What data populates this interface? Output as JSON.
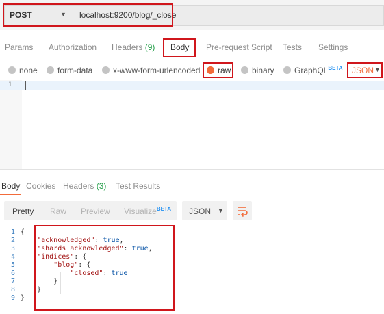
{
  "request": {
    "method": "POST",
    "url": "localhost:9200/blog/_close"
  },
  "request_tabs": {
    "params": "Params",
    "authorization": "Authorization",
    "headers": "Headers",
    "headers_count": "(9)",
    "body": "Body",
    "prerequest": "Pre-request Script",
    "tests": "Tests",
    "settings": "Settings"
  },
  "body_types": {
    "none": "none",
    "form_data": "form-data",
    "urlencoded": "x-www-form-urlencoded",
    "raw": "raw",
    "binary": "binary",
    "graphql": "GraphQL",
    "graphql_badge": "BETA",
    "selected_format": "JSON"
  },
  "request_editor": {
    "line_numbers": [
      "1"
    ]
  },
  "response_tabs": {
    "body": "Body",
    "cookies": "Cookies",
    "headers": "Headers",
    "headers_count": "(3)",
    "test_results": "Test Results"
  },
  "response_view": {
    "pretty": "Pretty",
    "raw": "Raw",
    "preview": "Preview",
    "visualize": "Visualize",
    "visualize_badge": "BETA",
    "format": "JSON"
  },
  "response_code": {
    "line_numbers": [
      "1",
      "2",
      "3",
      "4",
      "5",
      "6",
      "7",
      "8",
      "9"
    ],
    "l1": "{",
    "l2_key": "\"acknowledged\"",
    "l2_val": "true",
    "l3_key": "\"shards_acknowledged\"",
    "l3_val": "true",
    "l4_key": "\"indices\"",
    "l4_rest": "{",
    "l5_key": "\"blog\"",
    "l5_rest": "{",
    "l6_key": "\"closed\"",
    "l6_val": "true",
    "l7": "}",
    "l8": "}",
    "l9": "}"
  },
  "colors": {
    "accent": "#f26b3a",
    "highlight_red": "#d0161c",
    "count_green": "#27a04b",
    "beta_blue": "#1f8ff2"
  },
  "icons": {
    "method_caret": "chevron-down-icon",
    "format_caret": "chevron-down-icon",
    "wrap": "wrap-lines-icon"
  }
}
